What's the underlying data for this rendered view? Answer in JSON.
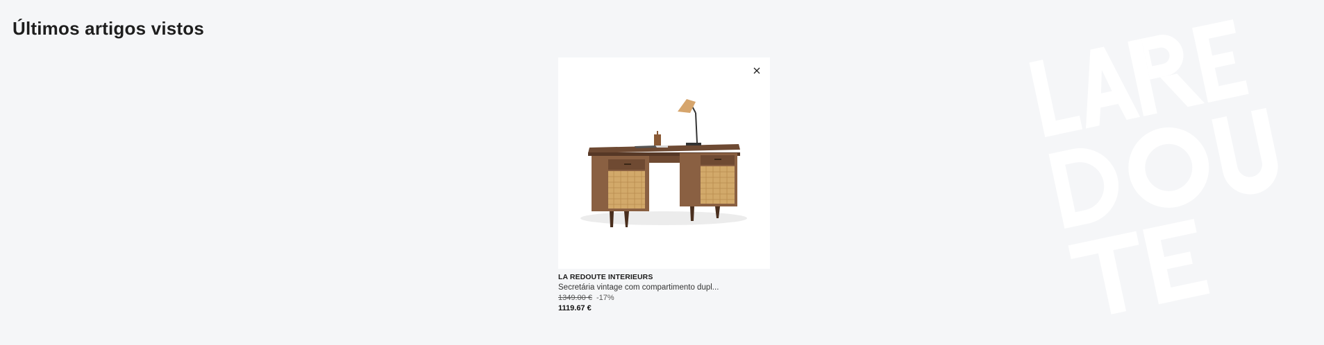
{
  "section": {
    "title": "Últimos artigos vistos"
  },
  "watermark": {
    "logo_text": "LA REDOUTE",
    "color": "#ffffff"
  },
  "product": {
    "brand": "LA REDOUTE INTERIEURS",
    "name": "Secretária vintage com compartimento dupl...",
    "old_price": "1349.00 €",
    "discount": "-17%",
    "price": "1119.67 €",
    "image_alt": "Secretária vintage em madeira com portas em palhinha",
    "close_icon": "close-icon"
  },
  "colors": {
    "background": "#f5f6f8",
    "text": "#1c1c1c"
  }
}
